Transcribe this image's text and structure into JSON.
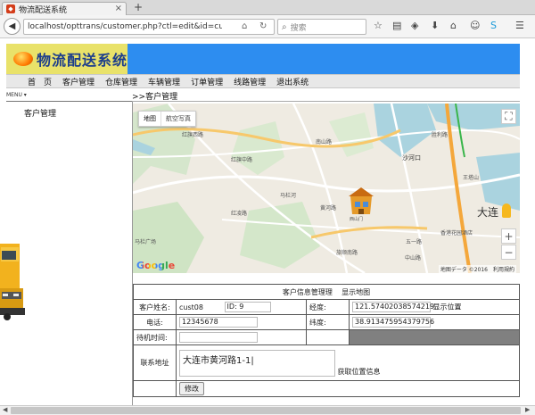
{
  "browser": {
    "tab_title": "物流配送系统",
    "url": "localhost/opttrans/customer.php?ctl=edit&id=cust08&p",
    "search_placeholder": "搜索",
    "new_tab": "+"
  },
  "site": {
    "logo_text": "物流配送系统",
    "menu": [
      "首　页",
      "客户管理",
      "仓库管理",
      "车辆管理",
      "订单管理",
      "线路管理",
      "退出系统"
    ],
    "side_header": "MENU ▾",
    "side_link": "客户管理",
    "breadcrumb": ">>客户管理"
  },
  "map": {
    "type_map": "地图",
    "type_satellite": "航空写真",
    "city_label": "大连",
    "footer": "地图データ ©2016　利用規約",
    "google": "Google",
    "labels": [
      "红旗西路",
      "红旗中路",
      "红凌路",
      "马栏河",
      "黄河路",
      "沙河口",
      "西山门",
      "马栏广场",
      "香港花园酒店",
      "王塔山",
      "五一路",
      "中山路",
      "旅顺南路",
      "胜利路",
      "南山路"
    ]
  },
  "form": {
    "caption_title": "客户信息管理理",
    "caption_link": "显示地图",
    "name_label": "客户姓名:",
    "name_value": "cust08",
    "id_label": "ID: 9",
    "lng_label": "经度:",
    "lng_value": "121.57402038574219",
    "show_pos": "显示位置",
    "phone_label": "电话:",
    "phone_value": "12345678",
    "lat_label": "纬度:",
    "lat_value": "38.913475954379756",
    "time_label": "待机时间:",
    "time_value": "",
    "address_label": "联系地址",
    "address_value": "大连市黄河路1-1|",
    "get_pos": "获取位置信息",
    "submit": "修改"
  }
}
